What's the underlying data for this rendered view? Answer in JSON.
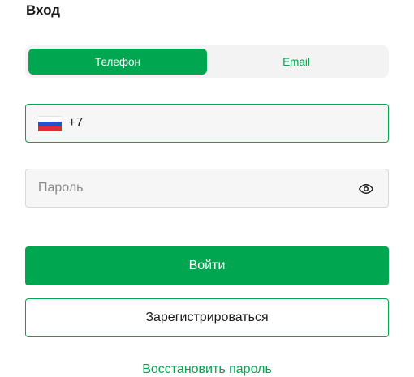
{
  "page": {
    "title": "Вход"
  },
  "tabs": [
    {
      "label": "Телефон",
      "active": true
    },
    {
      "label": "Email",
      "active": false
    }
  ],
  "phone": {
    "value": "+7",
    "country_flag": "flag-ru"
  },
  "password": {
    "placeholder": "Пароль",
    "icon": "eye-icon"
  },
  "actions": {
    "login_label": "Войти",
    "register_label": "Зарегистрироваться",
    "restore_label": "Восстановить пароль"
  },
  "colors": {
    "accent": "#00a650",
    "field_background": "#f6f6f6",
    "tabs_background": "#f2f3f2"
  }
}
